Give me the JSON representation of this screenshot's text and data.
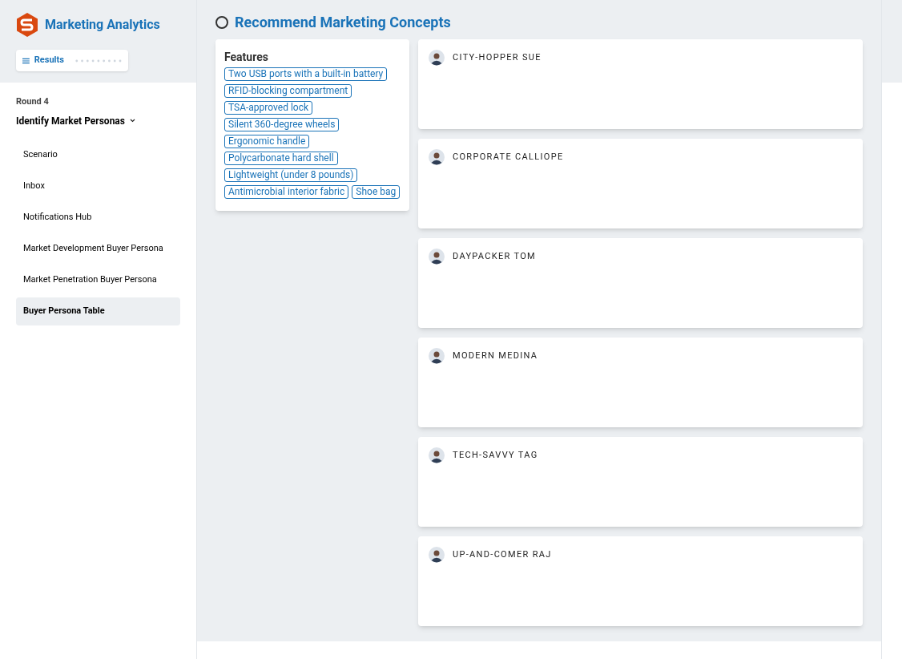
{
  "app": {
    "title": "Marketing Analytics",
    "results_button": "Results"
  },
  "sidebar": {
    "round": "Round 4",
    "stage": "Identify Market Personas",
    "items": [
      {
        "label": "Scenario",
        "selected": false
      },
      {
        "label": "Inbox",
        "selected": false
      },
      {
        "label": "Notifications Hub",
        "selected": false
      },
      {
        "label": "Market Development Buyer Persona",
        "selected": false
      },
      {
        "label": "Market Penetration Buyer Persona",
        "selected": false
      },
      {
        "label": "Buyer Persona Table",
        "selected": true
      }
    ]
  },
  "page": {
    "title": "Recommend Marketing Concepts",
    "completed": false
  },
  "features": {
    "title": "Features",
    "tags": [
      "Two USB ports with a built-in battery",
      "RFID-blocking compartment",
      "TSA-approved lock",
      "Silent 360-degree wheels",
      "Ergonomic handle",
      "Polycarbonate hard shell",
      "Lightweight (under 8 pounds)",
      "Antimicrobial interior fabric",
      "Shoe bag"
    ]
  },
  "personas": [
    {
      "name": "CITY-HOPPER SUE"
    },
    {
      "name": "CORPORATE CALLIOPE"
    },
    {
      "name": "DAYPACKER TOM"
    },
    {
      "name": "MODERN MEDINA"
    },
    {
      "name": "TECH-SAVVY TAG"
    },
    {
      "name": "UP-AND-COMER RAJ"
    }
  ]
}
